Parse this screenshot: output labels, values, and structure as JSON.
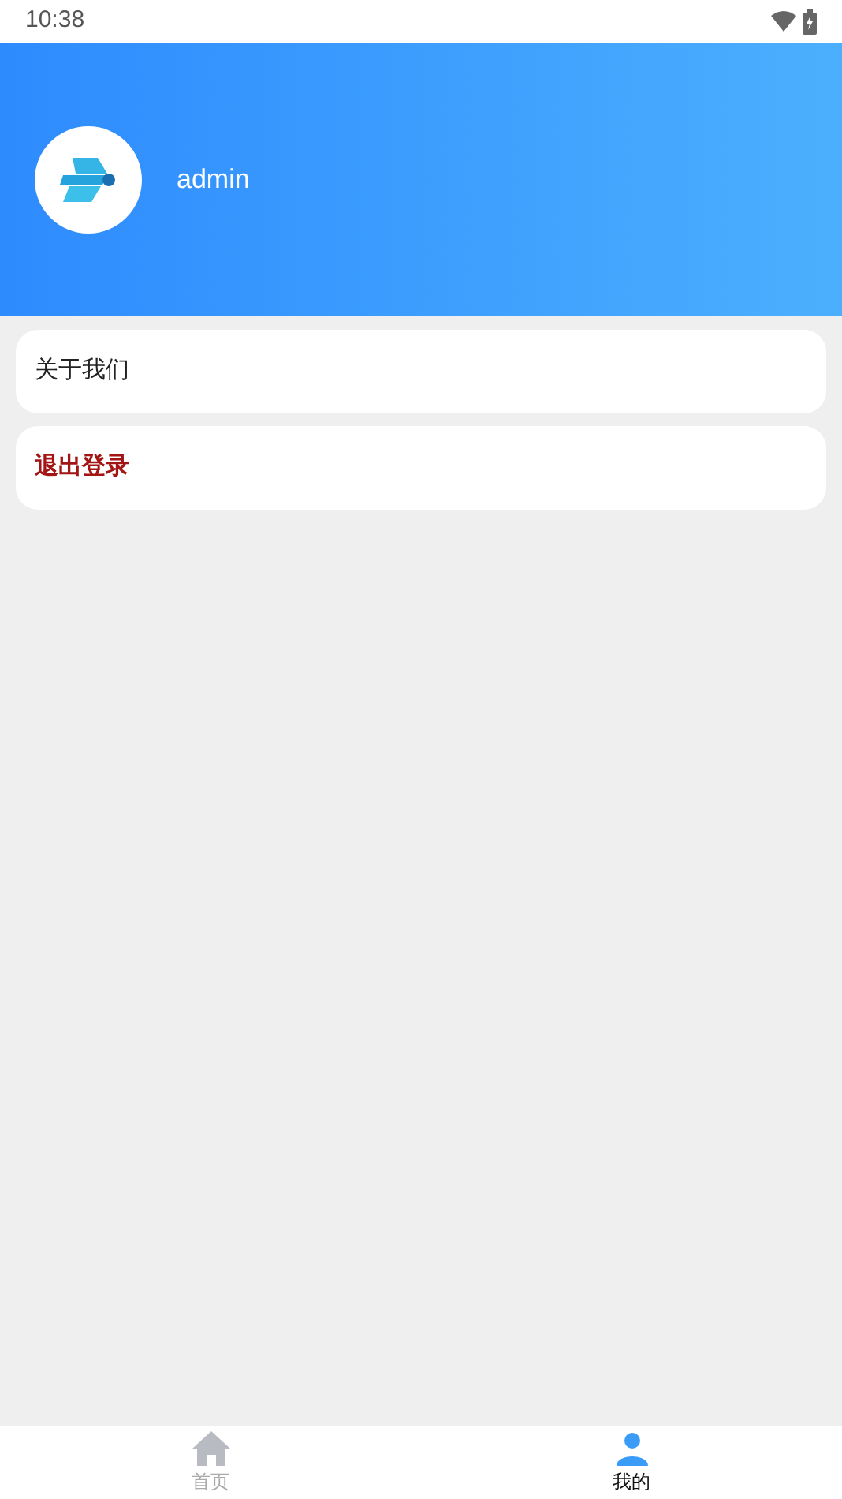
{
  "status_bar": {
    "time": "10:38"
  },
  "profile": {
    "username": "admin"
  },
  "menu": [
    {
      "label": "关于我们",
      "kind": "normal"
    },
    {
      "label": "退出登录",
      "kind": "danger"
    }
  ],
  "tab_bar": [
    {
      "label": "首页",
      "kind": "home",
      "selected": false
    },
    {
      "label": "我的",
      "kind": "profile",
      "selected": true
    }
  ]
}
